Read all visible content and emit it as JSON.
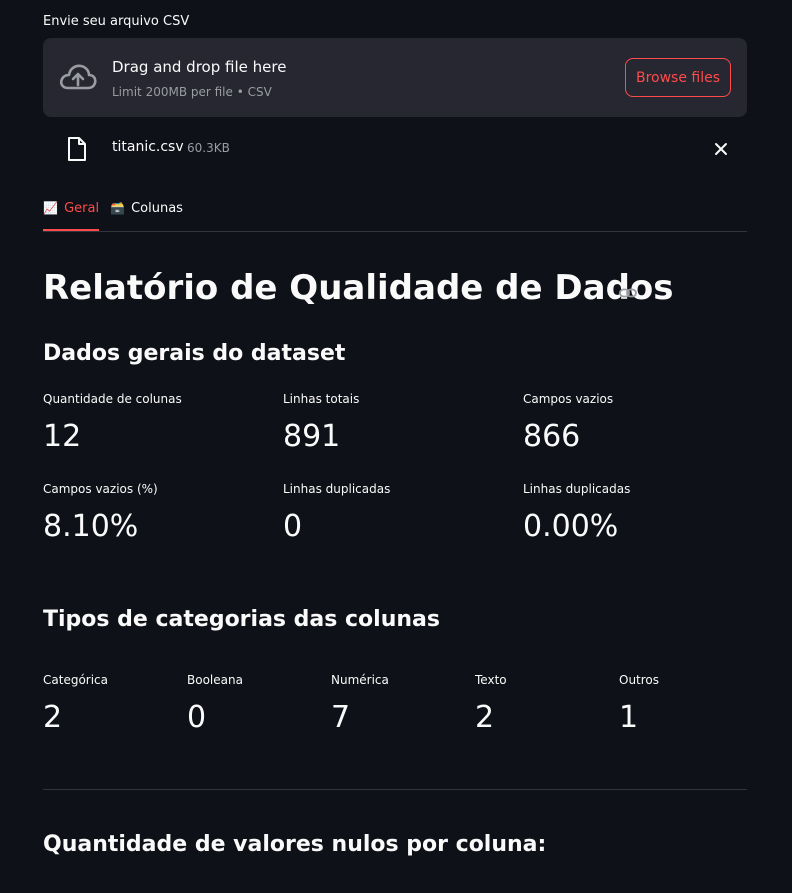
{
  "uploader": {
    "label": "Envie seu arquivo CSV",
    "drop_title": "Drag and drop file here",
    "drop_subtitle": "Limit 200MB per file • CSV",
    "browse_label": "Browse files",
    "icon": "cloud-upload-icon"
  },
  "file": {
    "name": "titanic.csv",
    "size": "60.3KB",
    "icon": "file-icon",
    "remove_icon": "close-icon"
  },
  "tabs": [
    {
      "emoji": "📈",
      "label": "Geral",
      "active": true
    },
    {
      "emoji": "🗃️",
      "label": "Colunas",
      "active": false
    }
  ],
  "report": {
    "title": "Relatório de Qualidade de Dados",
    "general_heading": "Dados gerais do dataset",
    "general_metrics": [
      {
        "label": "Quantidade de colunas",
        "value": "12"
      },
      {
        "label": "Linhas totais",
        "value": "891"
      },
      {
        "label": "Campos vazios",
        "value": "866"
      },
      {
        "label": "Campos vazios (%)",
        "value": "8.10%"
      },
      {
        "label": "Linhas duplicadas",
        "value": "0"
      },
      {
        "label": "Linhas duplicadas",
        "value": "0.00%"
      }
    ],
    "types_heading": "Tipos de categorias das colunas",
    "type_metrics": [
      {
        "label": "Categórica",
        "value": "2"
      },
      {
        "label": "Booleana",
        "value": "0"
      },
      {
        "label": "Numérica",
        "value": "7"
      },
      {
        "label": "Texto",
        "value": "2"
      },
      {
        "label": "Outros",
        "value": "1"
      }
    ],
    "nulls_heading": "Quantidade de valores nulos por coluna:"
  },
  "colors": {
    "background": "#0e1117",
    "accent": "#ff4b4b",
    "panel": "#262730",
    "muted_text": "#9a9ca3"
  }
}
